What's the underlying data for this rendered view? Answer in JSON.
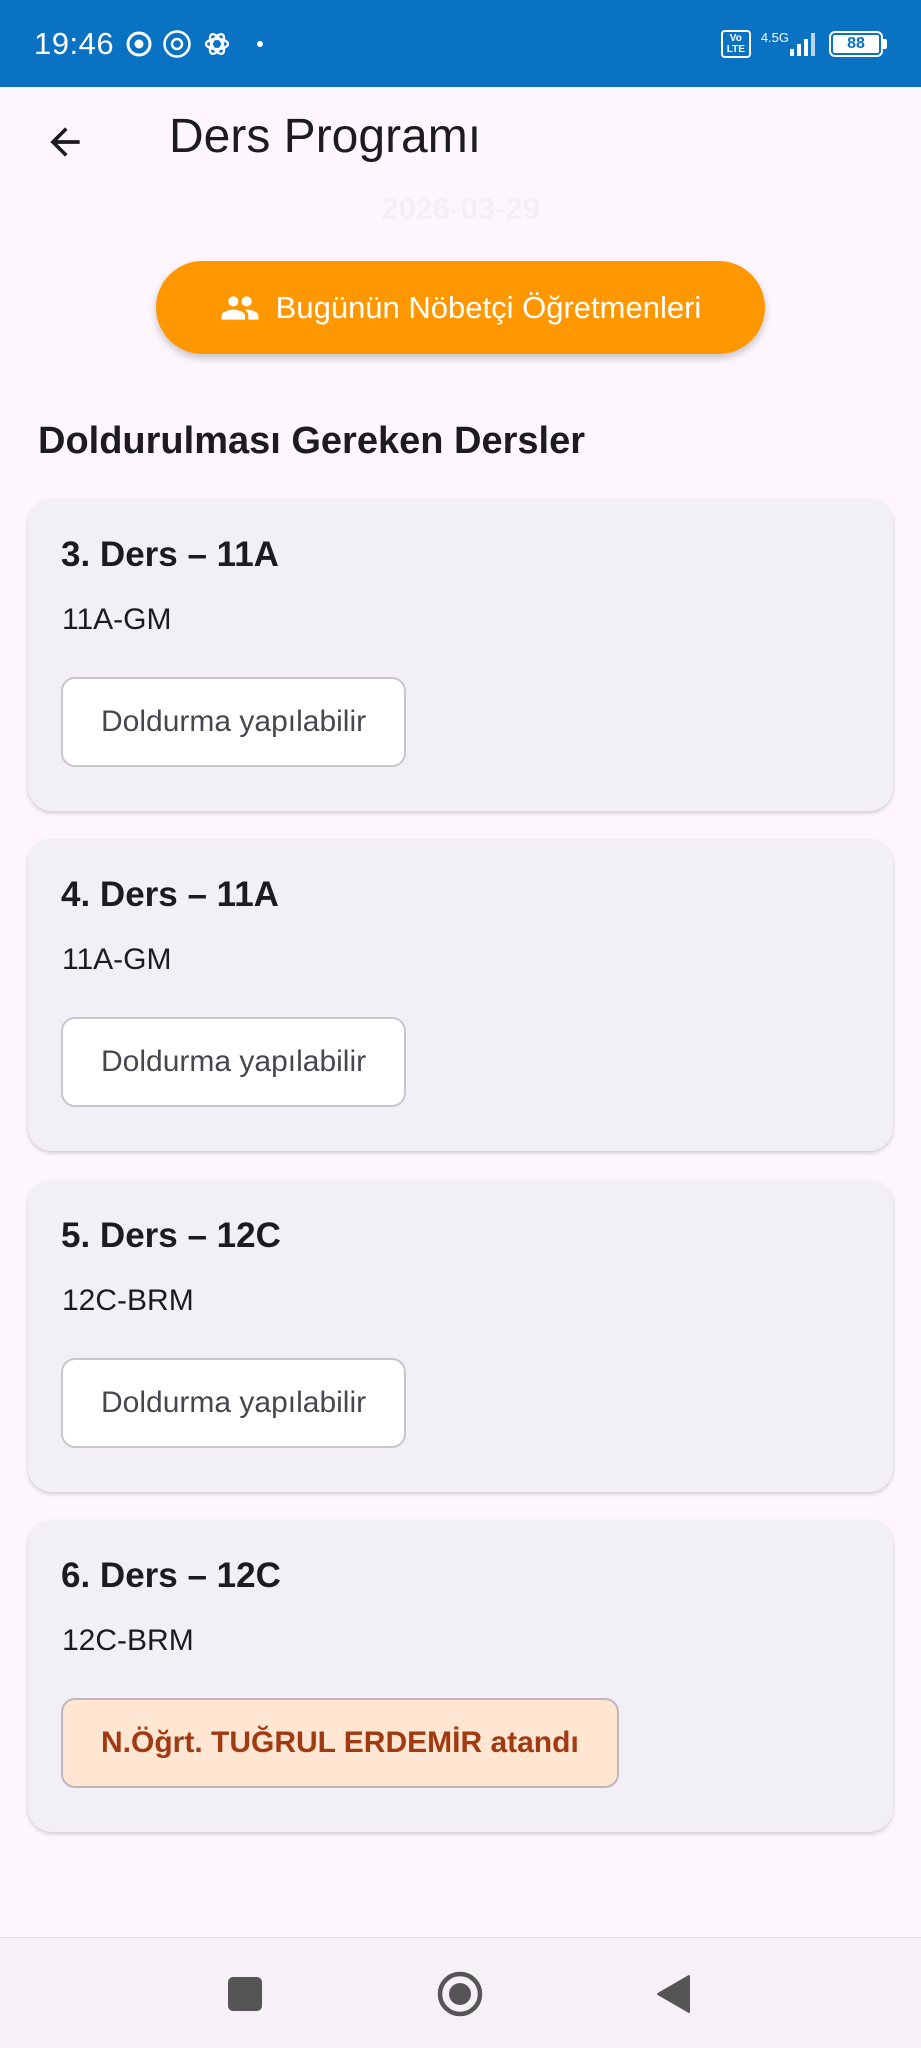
{
  "status_bar": {
    "time": "19:46",
    "network_type": "4.5G",
    "volte": "Vo LTE",
    "battery": "88"
  },
  "app_bar": {
    "title": "Ders Programı"
  },
  "date": "2026-03-29",
  "duty_button": {
    "label": "Bugünün Nöbetçi Öğretmenleri"
  },
  "section_title": "Doldurulması Gereken Dersler",
  "lessons": [
    {
      "title": "3. Ders – 11A",
      "subtitle": "11A-GM",
      "status": "Doldurma yapılabilir"
    },
    {
      "title": "4. Ders – 11A",
      "subtitle": "11A-GM",
      "status": "Doldurma yapılabilir"
    },
    {
      "title": "5. Ders – 12C",
      "subtitle": "12C-BRM",
      "status": "Doldurma yapılabilir"
    },
    {
      "title": "6. Ders – 12C",
      "subtitle": "12C-BRM",
      "status": "N.Öğrt. TUĞRUL ERDEMİR atandı"
    }
  ],
  "colors": {
    "status_bar": "#0a72c3",
    "accent": "#ff9800",
    "assigned_bg": "#ffe6d2",
    "assigned_text": "#a03a13"
  }
}
